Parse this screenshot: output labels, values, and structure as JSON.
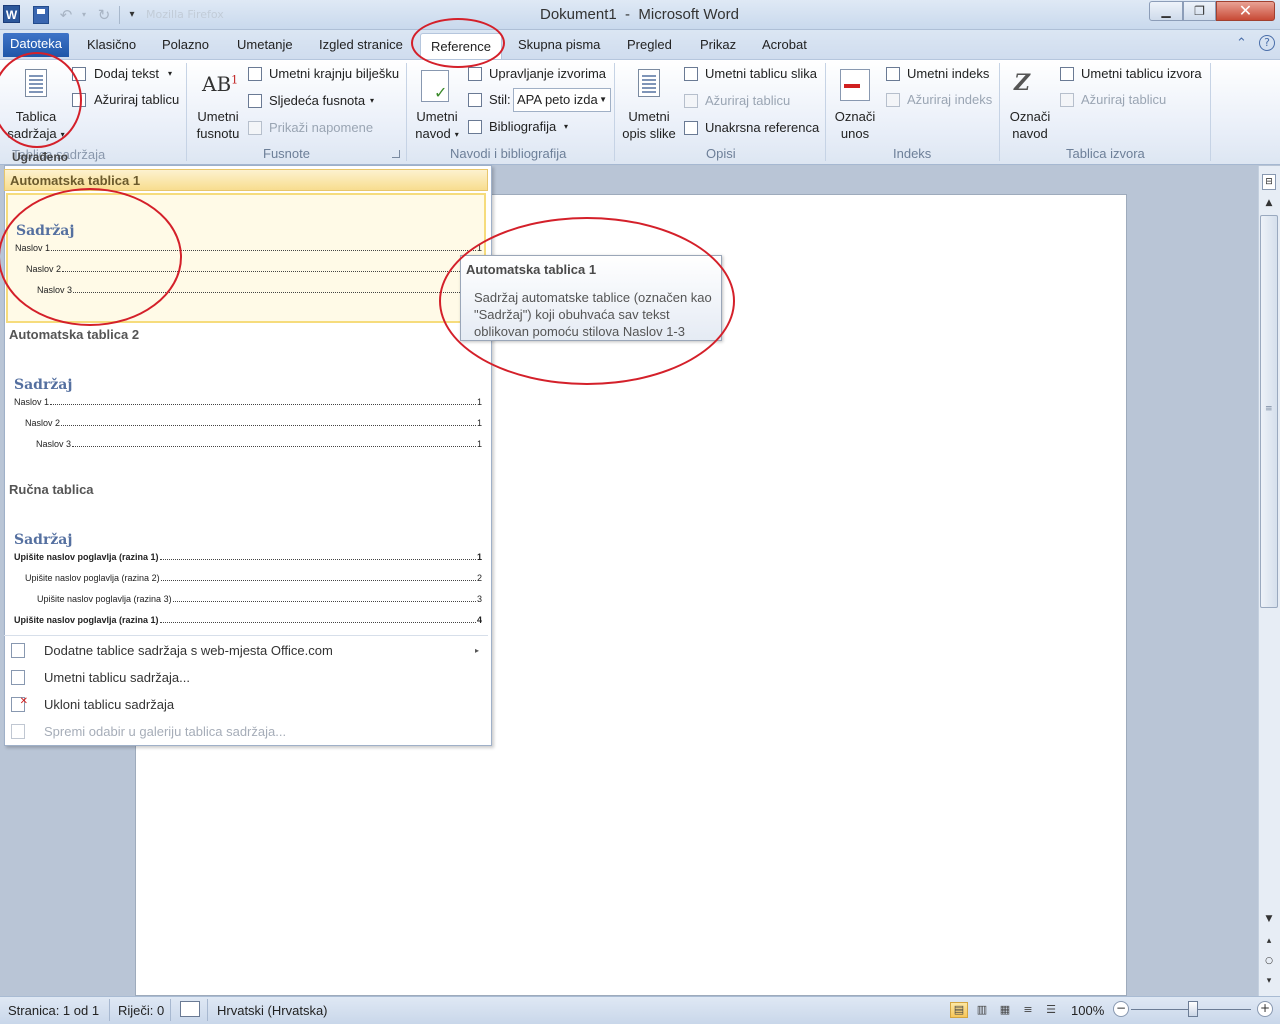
{
  "window": {
    "app_icon": "W",
    "title": "Dokument1  -  Microsoft Word",
    "ghost_text": "Mozilla Firefox",
    "minimize_icon": "minimize-icon",
    "maximize_icon": "restore-icon",
    "close_icon": "close-icon"
  },
  "qat": {
    "undo": "↶",
    "redo": "↻",
    "undo_arrow": "▾",
    "customize": "▾"
  },
  "tabs": {
    "file": "Datoteka",
    "items": [
      "Klasično",
      "Polazno",
      "Umetanje",
      "Izgled stranice",
      "Reference",
      "Skupna pisma",
      "Pregled",
      "Prikaz",
      "Acrobat"
    ],
    "active": "Reference"
  },
  "help": {
    "caret": "⌃",
    "help": "?"
  },
  "ribbon": {
    "toc_group": {
      "big_button": "Tablica sadržaja",
      "big_button_line1": "Tablica",
      "big_button_line2": "sadržaja",
      "add_text": "Dodaj tekst",
      "update_table": "Ažuriraj tablicu",
      "label": "Tablica sadržaja"
    },
    "footnotes_group": {
      "insert_footnote_line1": "Umetni",
      "insert_footnote_line2": "fusnotu",
      "insert_endnote": "Umetni krajnju bilješku",
      "next_footnote": "Sljedeća fusnota",
      "show_notes": "Prikaži napomene",
      "label": "Fusnote",
      "ab_icon": "AB",
      "ab_sup": "1"
    },
    "citations_group": {
      "insert_citation_line1": "Umetni",
      "insert_citation_line2": "navod",
      "manage_sources": "Upravljanje izvorima",
      "style_label": "Stil:",
      "style_value": "APA peto izda",
      "bibliography": "Bibliografija",
      "label": "Navodi i bibliografija"
    },
    "captions_group": {
      "insert_caption_line1": "Umetni",
      "insert_caption_line2": "opis slike",
      "insert_table_of_figures": "Umetni tablicu slika",
      "update_table": "Ažuriraj tablicu",
      "cross_reference": "Unakrsna referenca",
      "label": "Opisi"
    },
    "index_group": {
      "mark_entry_line1": "Označi",
      "mark_entry_line2": "unos",
      "insert_index": "Umetni indeks",
      "update_index": "Ažuriraj indeks",
      "label": "Indeks"
    },
    "authorities_group": {
      "mark_citation_line1": "Označi",
      "mark_citation_line2": "navod",
      "insert_table_of_authorities": "Umetni tablicu izvora",
      "update_table": "Ažuriraj tablicu",
      "label": "Tablica izvora"
    }
  },
  "gallery": {
    "header_partial": "Ugrađeno",
    "sections": [
      {
        "title": "Automatska tablica 1",
        "toc_title": "Sadržaj",
        "rows": [
          {
            "text": "Naslov 1",
            "page": "1"
          },
          {
            "text": "Naslov 2",
            "page": "1"
          },
          {
            "text": "Naslov 3",
            "page": "1"
          }
        ]
      },
      {
        "title": "Automatska tablica 2",
        "toc_title": "Sadržaj",
        "rows": [
          {
            "text": "Naslov 1",
            "page": "1"
          },
          {
            "text": "Naslov 2",
            "page": "1"
          },
          {
            "text": "Naslov 3",
            "page": "1"
          }
        ]
      },
      {
        "title": "Ručna tablica",
        "toc_title": "Sadržaj",
        "rows": [
          {
            "text": "Upišite naslov poglavlja (razina 1)",
            "page": "1"
          },
          {
            "text": "Upišite naslov poglavlja (razina 2)",
            "page": "2"
          },
          {
            "text": "Upišite naslov poglavlja (razina 3)",
            "page": "3"
          },
          {
            "text": "Upišite naslov poglavlja (razina 1)",
            "page": "4"
          }
        ]
      }
    ],
    "menu": [
      {
        "label": "Dodatne tablice sadržaja s web-mjesta Office.com",
        "has_submenu": true,
        "disabled": false,
        "submenu_icon": "▸"
      },
      {
        "label": "Umetni tablicu sadržaja...",
        "disabled": false
      },
      {
        "label": "Ukloni tablicu sadržaja",
        "disabled": false
      },
      {
        "label": "Spremi odabir u galeriju tablica sadržaja...",
        "disabled": true
      }
    ]
  },
  "tooltip": {
    "title": "Automatska tablica 1",
    "body": "Sadržaj automatske tablice (označen kao \"Sadržaj\") koji obuhvaća sav tekst oblikovan pomoću stilova Naslov 1-3"
  },
  "statusbar": {
    "page": "Stranica: 1 od 1",
    "words": "Riječi: 0",
    "language": "Hrvatski (Hrvatska)",
    "zoom": "100%",
    "zoom_minus": "−",
    "zoom_plus": "+"
  },
  "scrollbar": {
    "up": "▲",
    "down": "▼",
    "prev": "▴",
    "select": "○",
    "next": "▾",
    "ruler": "⊟"
  },
  "colors": {
    "accent": "#2b579a",
    "file_tab": "#2a63b8",
    "annotation": "#d4202a",
    "highlight": "#f8dd8f"
  }
}
